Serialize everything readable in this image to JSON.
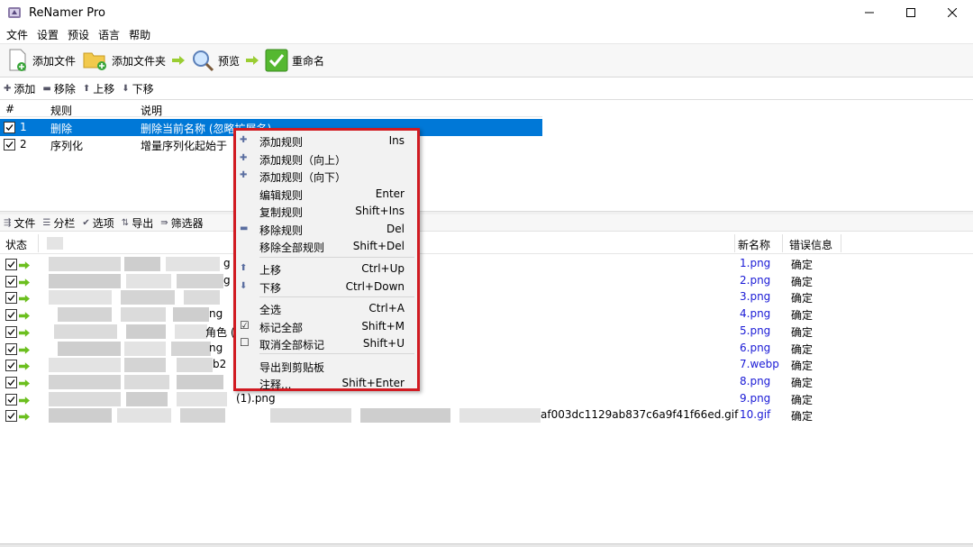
{
  "window": {
    "title": "ReNamer Pro"
  },
  "menubar": [
    "文件",
    "设置",
    "预设",
    "语言",
    "帮助"
  ],
  "toolbar": {
    "add_files": "添加文件",
    "add_folder": "添加文件夹",
    "preview": "预览",
    "rename": "重命名"
  },
  "rules_toolbar": {
    "add": "添加",
    "remove": "移除",
    "up": "上移",
    "down": "下移"
  },
  "rules_table": {
    "headers": {
      "num": "#",
      "rule": "规则",
      "desc": "说明"
    },
    "rows": [
      {
        "num": "1",
        "rule": "删除",
        "desc": "删除当前名称 (忽略扩展名)",
        "checked": true,
        "selected": true
      },
      {
        "num": "2",
        "rule": "序列化",
        "desc": "增量序列化起始于",
        "checked": true,
        "selected": false
      }
    ]
  },
  "files_toolbar": {
    "files": "文件",
    "columns": "分栏",
    "options": "选项",
    "export": "导出",
    "filter": "筛选器"
  },
  "files_table": {
    "headers": {
      "status": "状态",
      "new_name": "新名称",
      "error": "错误信息"
    },
    "rows": [
      {
        "tail": "g",
        "new_name": "1.png",
        "error": "确定"
      },
      {
        "tail": "g",
        "new_name": "2.png",
        "error": "确定"
      },
      {
        "tail": "",
        "new_name": "3.png",
        "error": "确定"
      },
      {
        "tail": "ng",
        "new_name": "4.png",
        "error": "确定"
      },
      {
        "tail": "角色 (",
        "new_name": "5.png",
        "error": "确定"
      },
      {
        "tail": "ng",
        "new_name": "6.png",
        "error": "确定"
      },
      {
        "tail": "b2",
        "new_name": "7.webp",
        "error": "确定"
      },
      {
        "tail": "",
        "new_name": "8.png",
        "error": "确定"
      },
      {
        "tail": "(1).png",
        "new_name": "9.png",
        "error": "确定"
      },
      {
        "tail": "af003dc1129ab837c6a9f41f66ed.gif",
        "new_name": "10.gif",
        "error": "确定"
      }
    ]
  },
  "context_menu": {
    "items": [
      {
        "label": "添加规则",
        "shortcut": "Ins",
        "icon": "plus-icon"
      },
      {
        "label": "添加规则（向上）",
        "shortcut": "",
        "icon": "plus-icon"
      },
      {
        "label": "添加规则（向下）",
        "shortcut": "",
        "icon": "plus-icon"
      },
      {
        "label": "编辑规则",
        "shortcut": "Enter",
        "icon": ""
      },
      {
        "label": "复制规则",
        "shortcut": "Shift+Ins",
        "icon": ""
      },
      {
        "label": "移除规则",
        "shortcut": "Del",
        "icon": "minus-icon"
      },
      {
        "label": "移除全部规则",
        "shortcut": "Shift+Del",
        "icon": ""
      },
      {
        "label": "上移",
        "shortcut": "Ctrl+Up",
        "icon": "arrow-up-icon"
      },
      {
        "label": "下移",
        "shortcut": "Ctrl+Down",
        "icon": "arrow-down-icon"
      },
      {
        "label": "全选",
        "shortcut": "Ctrl+A",
        "icon": ""
      },
      {
        "label": "标记全部",
        "shortcut": "Shift+M",
        "icon": "checkbox-checked-icon"
      },
      {
        "label": "取消全部标记",
        "shortcut": "Shift+U",
        "icon": "checkbox-empty-icon"
      },
      {
        "label": "导出到剪贴板",
        "shortcut": "",
        "icon": ""
      },
      {
        "label": "注释...",
        "shortcut": "Shift+Enter",
        "icon": ""
      }
    ]
  },
  "colors": {
    "selection": "#0078d7",
    "highlight_border": "#d11b22",
    "new_name": "#1a1ad6"
  }
}
